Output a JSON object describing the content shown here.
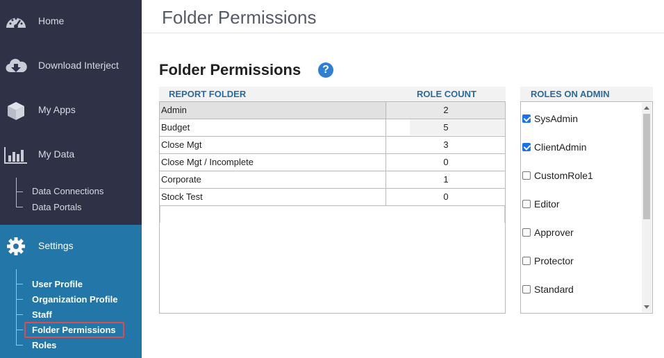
{
  "sidebar": {
    "items": [
      {
        "label": "Home",
        "icon": "dashboard-icon"
      },
      {
        "label": "Download Interject",
        "icon": "cloud-download-icon"
      },
      {
        "label": "My Apps",
        "icon": "box-icon"
      },
      {
        "label": "My Data",
        "icon": "bar-chart-icon"
      }
    ],
    "data_sub": [
      "Data Connections",
      "Data Portals"
    ],
    "settings": {
      "label": "Settings",
      "icon": "gear-icon",
      "sub": [
        "User Profile",
        "Organization Profile",
        "Staff",
        "Folder Permissions",
        "Roles"
      ]
    }
  },
  "header": {
    "title": "Folder Permissions"
  },
  "main": {
    "section_title": "Folder Permissions",
    "help": "?",
    "folder_table": {
      "columns": [
        "REPORT FOLDER",
        "ROLE COUNT"
      ],
      "rows": [
        {
          "folder": "Admin",
          "count": "2"
        },
        {
          "folder": "Budget",
          "count": "5"
        },
        {
          "folder": "Close Mgt",
          "count": "3"
        },
        {
          "folder": "Close Mgt / Incomplete",
          "count": "0"
        },
        {
          "folder": "Corporate",
          "count": "1"
        },
        {
          "folder": "Stock Test",
          "count": "0"
        }
      ]
    },
    "roles_panel": {
      "title": "ROLES ON ADMIN",
      "roles": [
        {
          "label": "SysAdmin",
          "checked": true
        },
        {
          "label": "ClientAdmin",
          "checked": true
        },
        {
          "label": "CustomRole1",
          "checked": false
        },
        {
          "label": "Editor",
          "checked": false
        },
        {
          "label": "Approver",
          "checked": false
        },
        {
          "label": "Protector",
          "checked": false
        },
        {
          "label": "Standard",
          "checked": false
        }
      ]
    }
  },
  "colors": {
    "sidebar_bg": "#2f3146",
    "settings_bg": "#2377a8",
    "header_text": "#2b6aa0",
    "highlight": "#e04b4b",
    "help_icon": "#2f7fd4"
  }
}
